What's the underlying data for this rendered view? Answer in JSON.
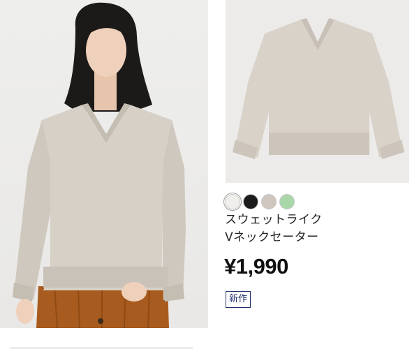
{
  "product": {
    "name_line1": "スウェットライク",
    "name_line2": "Vネックセーター",
    "price": "¥1,990",
    "badge": "新作",
    "images": {
      "model_icon": "model-photo-icon",
      "flatlay_icon": "sweater-flatlay-icon"
    }
  },
  "swatches": [
    {
      "name": "off-white",
      "color": "#f0efec",
      "selected": true
    },
    {
      "name": "black",
      "color": "#1c1c1c",
      "selected": false
    },
    {
      "name": "beige",
      "color": "#cfc7bf",
      "selected": false
    },
    {
      "name": "green",
      "color": "#a9d7a8",
      "selected": false
    }
  ]
}
